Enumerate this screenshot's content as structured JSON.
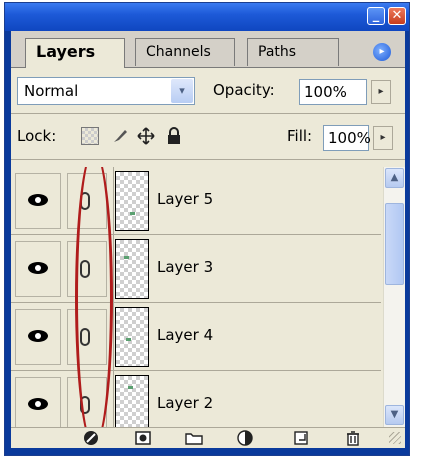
{
  "titlebar": {
    "minimize_symbol": "_",
    "close_symbol": "✕"
  },
  "tabs": [
    {
      "label": "Layers",
      "active": true
    },
    {
      "label": "Channels",
      "active": false
    },
    {
      "label": "Paths",
      "active": false
    }
  ],
  "panel_menu_symbol": "▸",
  "blend_mode": {
    "value": "Normal",
    "arrow": "▾"
  },
  "opacity": {
    "label": "Opacity:",
    "value": "100%",
    "stepper": "▸"
  },
  "lock": {
    "label": "Lock:",
    "icons": [
      "transparency-lock-icon",
      "brush-lock-icon",
      "move-lock-icon",
      "padlock-icon"
    ]
  },
  "fill": {
    "label": "Fill:",
    "value": "100%",
    "stepper": "▸"
  },
  "layers": [
    {
      "name": "Layer 5",
      "visible": true,
      "linked": true
    },
    {
      "name": "Layer 3",
      "visible": true,
      "linked": true
    },
    {
      "name": "Layer 4",
      "visible": true,
      "linked": true
    },
    {
      "name": "Layer 2",
      "visible": true,
      "linked": true
    }
  ],
  "scrollbar": {
    "up": "▲",
    "down": "▼"
  },
  "bottom_icons": [
    "layer-style-icon",
    "layer-mask-icon",
    "new-group-icon",
    "adjustment-layer-icon",
    "new-layer-icon",
    "trash-icon"
  ],
  "colors": {
    "titlebar": "#1d5ad8",
    "panel_bg": "#ece9d8",
    "annotation_oval": "#b01c1c"
  }
}
